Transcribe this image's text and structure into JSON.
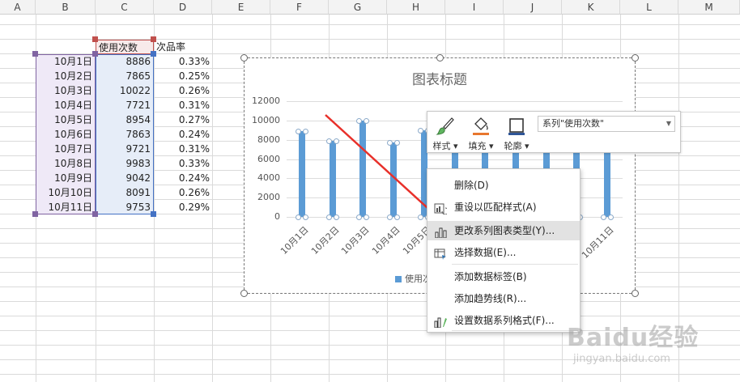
{
  "columns": [
    "A",
    "B",
    "C",
    "D",
    "E",
    "F",
    "G",
    "H",
    "I",
    "J",
    "K",
    "L",
    "M"
  ],
  "table": {
    "header_count": "使用次数",
    "header_rate": "次品率",
    "rows": [
      {
        "date": "10月1日",
        "count": "8886",
        "rate": "0.33%"
      },
      {
        "date": "10月2日",
        "count": "7865",
        "rate": "0.25%"
      },
      {
        "date": "10月3日",
        "count": "10022",
        "rate": "0.26%"
      },
      {
        "date": "10月4日",
        "count": "7721",
        "rate": "0.31%"
      },
      {
        "date": "10月5日",
        "count": "8954",
        "rate": "0.27%"
      },
      {
        "date": "10月6日",
        "count": "7863",
        "rate": "0.24%"
      },
      {
        "date": "10月7日",
        "count": "9721",
        "rate": "0.31%"
      },
      {
        "date": "10月8日",
        "count": "9983",
        "rate": "0.33%"
      },
      {
        "date": "10月9日",
        "count": "9042",
        "rate": "0.24%"
      },
      {
        "date": "10月10日",
        "count": "8091",
        "rate": "0.26%"
      },
      {
        "date": "10月11日",
        "count": "9753",
        "rate": "0.29%"
      }
    ]
  },
  "chart": {
    "title": "图表标题",
    "legend": "使用次",
    "y_ticks": [
      "0",
      "2000",
      "4000",
      "6000",
      "8000",
      "10000",
      "12000"
    ],
    "x_labels": [
      "10月1日",
      "10月2日",
      "10月3日",
      "10月4日",
      "10月5日",
      "10月11日"
    ],
    "values": [
      8886,
      7865,
      10022,
      7721,
      8954,
      7863,
      9721,
      9983,
      9042,
      8091,
      9753
    ],
    "ymax": 12000,
    "bar_color": "#5b9bd5"
  },
  "format_bar": {
    "style_label": "样式",
    "fill_label": "填充",
    "outline_label": "轮廓",
    "series_select": "系列\"使用次数\"",
    "fill_color": "#e8772e",
    "outline_color": "#2f5597"
  },
  "context_menu": {
    "items": [
      {
        "label": "删除(D)",
        "icon": "none-icon"
      },
      {
        "label": "重设以匹配样式(A)",
        "icon": "reset-style-icon"
      },
      {
        "label": "更改系列图表类型(Y)...",
        "icon": "bar-chart-icon"
      },
      {
        "label": "选择数据(E)...",
        "icon": "select-data-icon"
      },
      {
        "label": "添加数据标签(B)",
        "icon": "none-icon"
      },
      {
        "label": "添加趋势线(R)...",
        "icon": "none-icon"
      },
      {
        "label": "设置数据系列格式(F)...",
        "icon": "format-series-icon"
      }
    ]
  },
  "watermark": {
    "main": "Baidu经验",
    "sub": "jingyan.baidu.com"
  }
}
